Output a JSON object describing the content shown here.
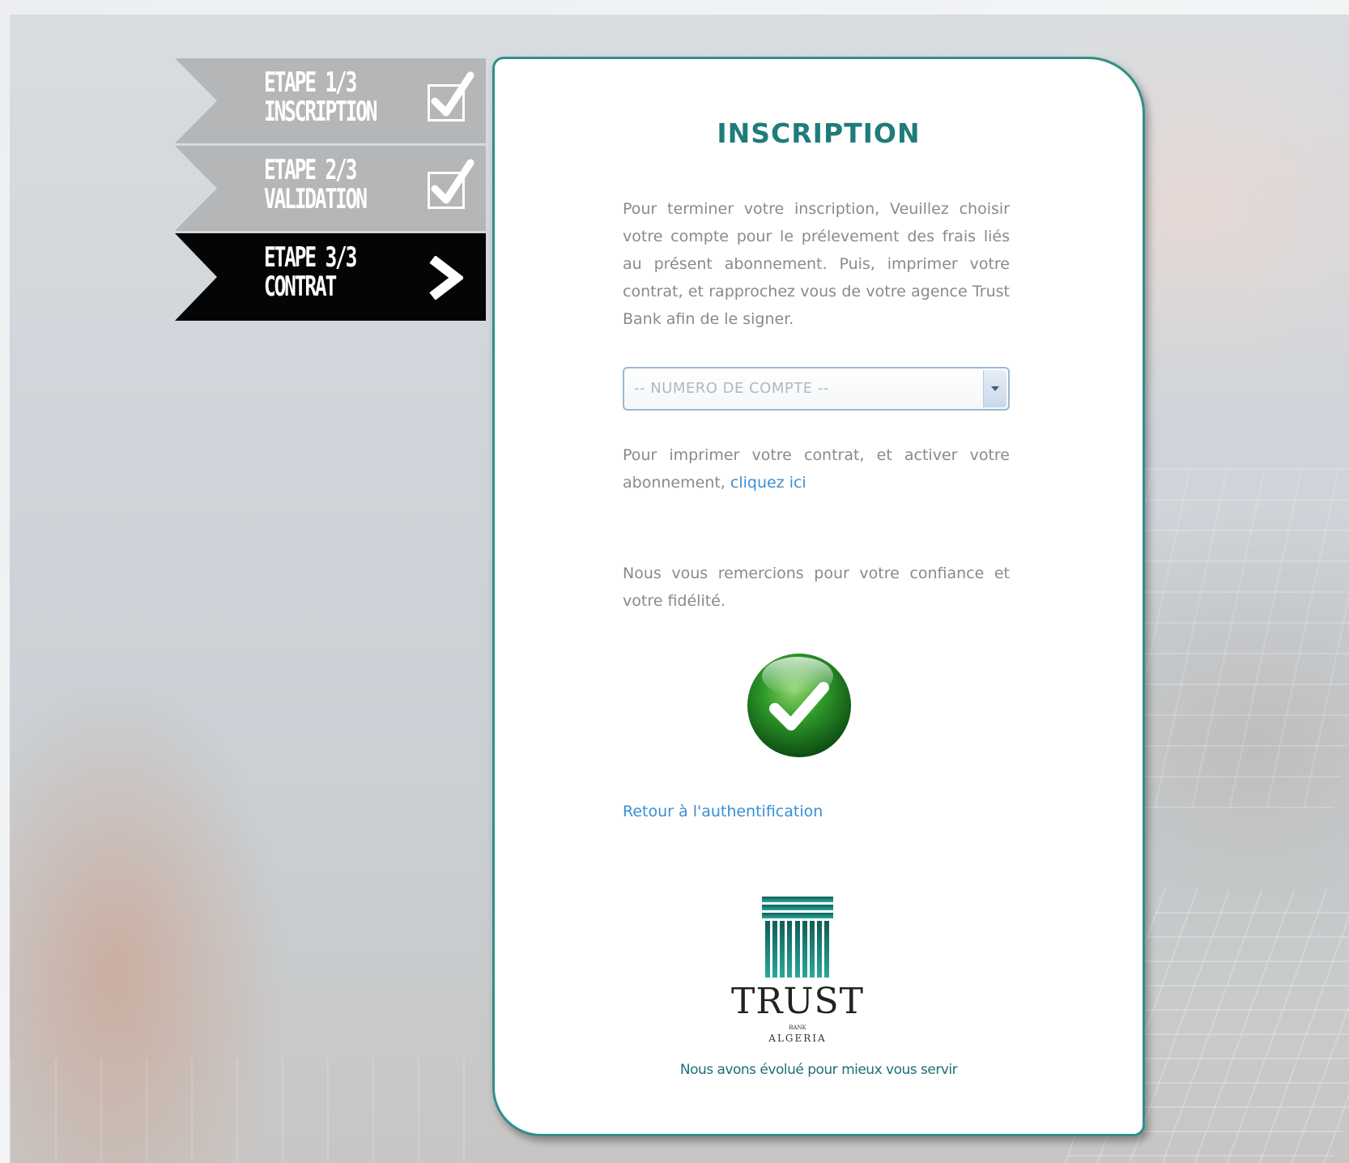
{
  "steps": [
    {
      "line1": "ETAPE 1/3",
      "line2": "INSCRIPTION",
      "status": "done",
      "icon": "checkbox-checked-icon"
    },
    {
      "line1": "ETAPE 2/3",
      "line2": "VALIDATION",
      "status": "done",
      "icon": "checkbox-checked-icon"
    },
    {
      "line1": "ETAPE 3/3",
      "line2": "CONTRAT",
      "status": "active",
      "icon": "chevron-right-icon"
    }
  ],
  "card": {
    "title": "INSCRIPTION",
    "intro": "Pour terminer votre inscription, Veuillez choisir votre compte pour le prélevement des frais liés au présent abonnement. Puis, imprimer votre contrat, et rapprochez vous de votre agence Trust Bank afin de le signer.",
    "account_select": {
      "value": "-- NUMERO DE COMPTE --"
    },
    "print_text": "Pour imprimer votre contrat, et activer votre abonnement,",
    "print_link": "cliquez ici",
    "thanks": "Nous vous remercions pour votre confiance et votre fidélité.",
    "success_icon": "green-checkmark-icon",
    "return_link": "Retour à l'authentification",
    "logo": {
      "wordmark": "TRUST",
      "sub1": "BANK",
      "sub2": "ALGERIA"
    },
    "tagline": "Nous avons évolué pour mieux vous servir"
  },
  "colors": {
    "accent": "#1f7c7a",
    "card_border": "#2f8f8a",
    "link": "#3a8fd4",
    "step_done": "#b4b6b8",
    "step_active": "#050505"
  }
}
